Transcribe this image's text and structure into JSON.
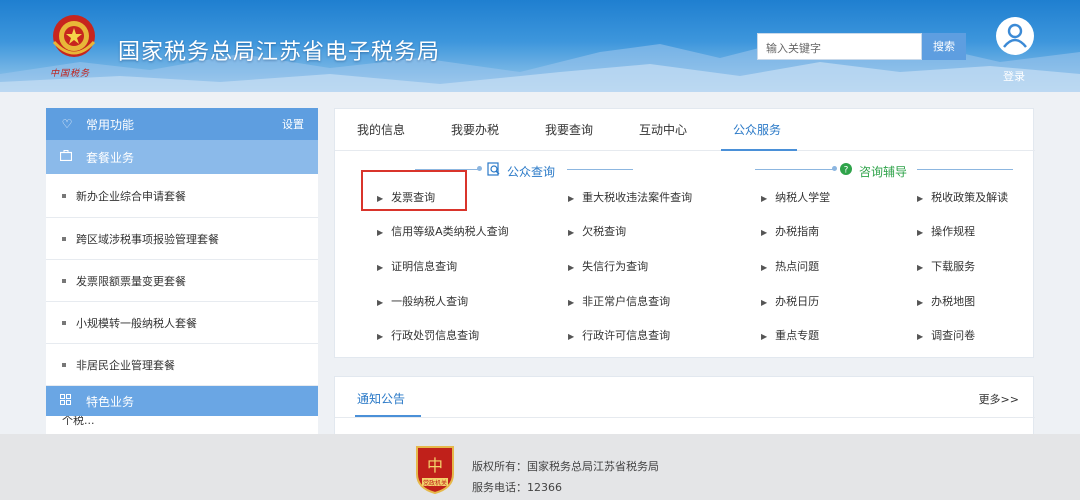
{
  "header": {
    "title": "国家税务总局江苏省电子税务局",
    "emblem_text": "中国税务",
    "search_placeholder": "输入关键字",
    "search_button": "搜索",
    "login_label": "登录"
  },
  "sidebar": {
    "frequent": {
      "icon": "heart-icon",
      "label": "常用功能",
      "settings": "设置"
    },
    "package": {
      "icon": "briefcase-icon",
      "label": "套餐业务"
    },
    "items": [
      {
        "label": "新办企业综合申请套餐"
      },
      {
        "label": "跨区域涉税事项报验管理套餐"
      },
      {
        "label": "发票限额票量变更套餐"
      },
      {
        "label": "小规模转一般纳税人套餐"
      },
      {
        "label": "非居民企业管理套餐"
      }
    ],
    "special": {
      "icon": "grid-icon",
      "label": "特色业务"
    },
    "cut_item": "个税..."
  },
  "main": {
    "tabs": [
      {
        "label": "我的信息"
      },
      {
        "label": "我要办税"
      },
      {
        "label": "我要查询"
      },
      {
        "label": "互动中心"
      },
      {
        "label": "公众服务",
        "active": true
      }
    ],
    "public_query": {
      "icon": "magnifier-doc-icon",
      "title": "公众查询"
    },
    "consult": {
      "icon": "help-icon",
      "title": "咨询辅导"
    },
    "services": [
      [
        "发票查询",
        "重大税收违法案件查询",
        "纳税人学堂",
        "税收政策及解读"
      ],
      [
        "信用等级A类纳税人查询",
        "欠税查询",
        "办税指南",
        "操作规程"
      ],
      [
        "证明信息查询",
        "失信行为查询",
        "热点问题",
        "下载服务"
      ],
      [
        "一般纳税人查询",
        "非正常户信息查询",
        "办税日历",
        "办税地图"
      ],
      [
        "行政处罚信息查询",
        "行政许可信息查询",
        "重点专题",
        "调查问卷"
      ]
    ]
  },
  "notice": {
    "title": "通知公告",
    "more": "更多>>"
  },
  "footer": {
    "badge_text": "党政机关",
    "copyright": "版权所有：国家税务总局江苏省税务局",
    "phone": "服务电话：12366"
  },
  "colors": {
    "brand_blue": "#2a79c7",
    "header_blue": "#1f7fd0",
    "sidebar_blue": "#5e9ee0",
    "highlight_red": "#d9342b",
    "consult_green": "#2fa34a"
  }
}
